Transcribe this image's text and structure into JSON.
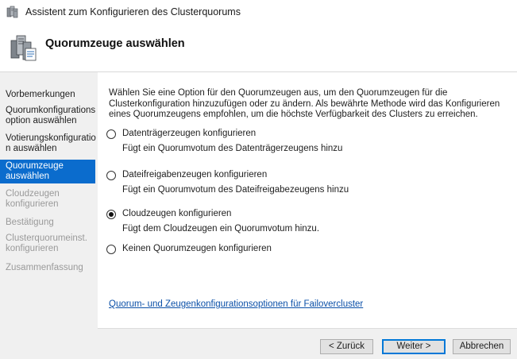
{
  "window": {
    "title": "Assistent zum Konfigurieren des Clusterquorums",
    "icon": "cluster-server-icon"
  },
  "header": {
    "title": "Quorumzeuge auswählen",
    "icon": "cluster-server-large-icon"
  },
  "nav": {
    "items": [
      {
        "label": "Vorbemerkungen",
        "state": "normal"
      },
      {
        "label": "Quorumkonfigurations option auswählen",
        "state": "normal"
      },
      {
        "label": "Votierungskonfiguratio n auswählen",
        "state": "normal"
      },
      {
        "label": "Quorumzeuge auswählen",
        "state": "active"
      },
      {
        "label": "Cloudzeugen konfigurieren",
        "state": "disabled"
      },
      {
        "label": "Bestätigung",
        "state": "disabled"
      },
      {
        "label": "Clusterquorumeinst. konfigurieren",
        "state": "disabled"
      },
      {
        "label": "Zusammenfassung",
        "state": "disabled"
      }
    ]
  },
  "main": {
    "intro": "Wählen Sie eine Option für den Quorumzeugen aus, um den Quorumzeugen für die Clusterkonfiguration hinzuzufügen oder zu ändern. Als bewährte Methode wird das Konfigurieren eines Quorumzeugens empfohlen, um die höchste Verfügbarkeit des Clusters zu erreichen.",
    "options": [
      {
        "label": "Datenträgerzeugen konfigurieren",
        "description": "Fügt ein Quorumvotum des Datenträgerzeugens hinzu",
        "checked": false
      },
      {
        "label": "Dateifreigabenzeugen konfigurieren",
        "description": "Fügt ein Quorumvotum des Dateifreigabezeugens hinzu",
        "checked": false
      },
      {
        "label": "Cloudzeugen konfigurieren",
        "description": "Fügt dem Cloudzeugen ein Quorumvotum hinzu.",
        "checked": true
      },
      {
        "label": "Keinen Quorumzeugen konfigurieren",
        "description": "",
        "checked": false
      }
    ],
    "help_link": "Quorum- und Zeugenkonfigurationsoptionen für Failovercluster"
  },
  "footer": {
    "back_label": "< Zurück",
    "next_label": "Weiter >",
    "cancel_label": "Abbrechen"
  },
  "colors": {
    "nav_active_bg": "#0b6ccd",
    "link": "#0b50a8",
    "default_button_border": "#0078d7"
  }
}
